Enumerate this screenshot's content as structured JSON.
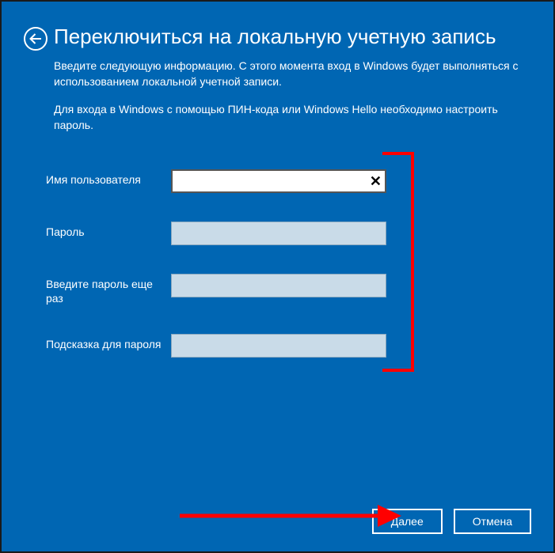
{
  "header": {
    "title": "Переключиться на локальную учетную запись"
  },
  "description": {
    "p1": "Введите следующую информацию. С этого момента вход в Windows будет выполняться с использованием локальной учетной записи.",
    "p2": "Для входа в Windows с помощью ПИН-кода или Windows Hello необходимо настроить пароль."
  },
  "form": {
    "username_label": "Имя пользователя",
    "username_value": "",
    "password_label": "Пароль",
    "password_value": "",
    "confirm_label": "Введите пароль еще раз",
    "confirm_value": "",
    "hint_label": "Подсказка для пароля",
    "hint_value": ""
  },
  "footer": {
    "next_label": "Далее",
    "cancel_label": "Отмена"
  },
  "icons": {
    "back": "back-arrow-icon",
    "clear": "✕"
  }
}
